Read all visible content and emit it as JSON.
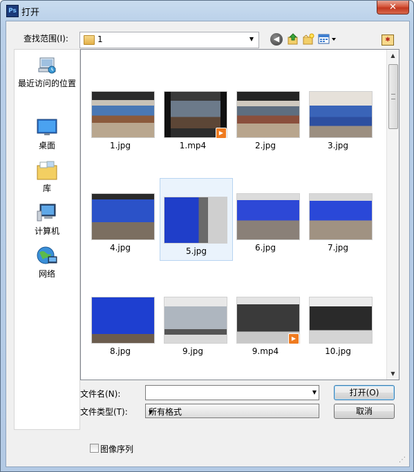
{
  "window": {
    "app_icon_text": "Ps",
    "title": "打开",
    "close_glyph": "✕"
  },
  "toolbar": {
    "look_in_label": "查找范围(I):",
    "look_in_value": "1",
    "icons": [
      "back-icon",
      "up-folder-icon",
      "new-folder-icon",
      "view-menu-icon",
      "favorites-icon"
    ]
  },
  "places": [
    {
      "label": "最近访问的位置",
      "icon": "recent-places-icon"
    },
    {
      "label": "桌面",
      "icon": "desktop-icon"
    },
    {
      "label": "库",
      "icon": "libraries-icon"
    },
    {
      "label": "计算机",
      "icon": "computer-icon"
    },
    {
      "label": "网络",
      "icon": "network-icon"
    }
  ],
  "files": [
    {
      "name": "1.jpg"
    },
    {
      "name": "1.mp4"
    },
    {
      "name": "2.jpg"
    },
    {
      "name": "3.jpg"
    },
    {
      "name": "4.jpg"
    },
    {
      "name": "5.jpg",
      "selected": true
    },
    {
      "name": "6.jpg"
    },
    {
      "name": "7.jpg"
    },
    {
      "name": "8.jpg"
    },
    {
      "name": "9.jpg"
    },
    {
      "name": "9.mp4"
    },
    {
      "name": "10.jpg"
    }
  ],
  "form": {
    "filename_label": "文件名(N):",
    "filename_value": "",
    "filetype_label": "文件类型(T):",
    "filetype_value": "所有格式",
    "open_button": "打开(O)",
    "cancel_button": "取消",
    "sequence_label": "图像序列"
  },
  "colors": {
    "accent": "#3c7fb1",
    "selection": "#eaf3fc",
    "video_badge": "#ef7b20"
  }
}
